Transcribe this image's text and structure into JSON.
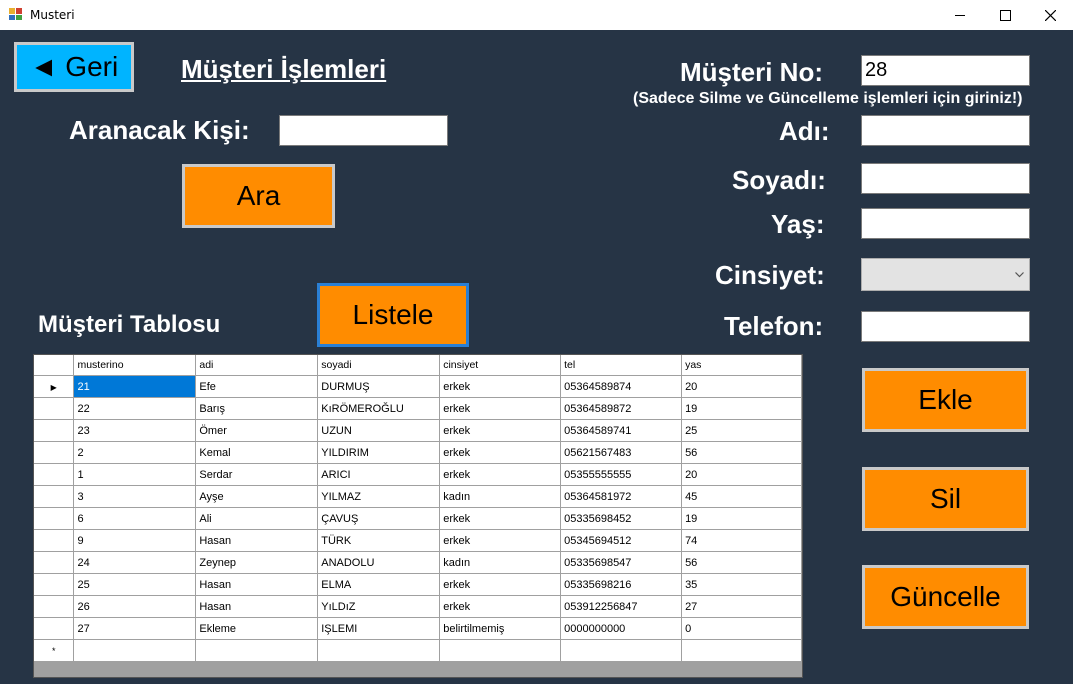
{
  "window": {
    "title": "Musteri",
    "minimize": "—",
    "maximize": "☐",
    "close": "✕"
  },
  "left": {
    "back_button": "◄ Geri",
    "heading": "Müşteri İşlemleri",
    "search_label": "Aranacak Kişi:",
    "search_value": "",
    "search_button": "Ara",
    "list_button": "Listele",
    "table_label": "Müşteri Tablosu"
  },
  "form": {
    "no_label": "Müşteri No:",
    "no_value": "28",
    "no_hint": "(Sadece Silme ve Güncelleme işlemleri için giriniz!)",
    "name_label": "Adı:",
    "name_value": "",
    "surname_label": "Soyadı:",
    "surname_value": "",
    "age_label": "Yaş:",
    "age_value": "",
    "gender_label": "Cinsiyet:",
    "gender_value": "",
    "phone_label": "Telefon:",
    "phone_value": "",
    "add_button": "Ekle",
    "delete_button": "Sil",
    "update_button": "Güncelle"
  },
  "grid": {
    "columns": [
      "musterino",
      "adi",
      "soyadi",
      "cinsiyet",
      "tel",
      "yas"
    ],
    "rows": [
      [
        "21",
        "Efe",
        "DURMUŞ",
        "erkek",
        "05364589874",
        "20"
      ],
      [
        "22",
        "Barış",
        "KıRÖMEROĞLU",
        "erkek",
        "05364589872",
        "19"
      ],
      [
        "23",
        "Ömer",
        "UZUN",
        "erkek",
        "05364589741",
        "25"
      ],
      [
        "2",
        "Kemal",
        "YILDIRIM",
        "erkek",
        "05621567483",
        "56"
      ],
      [
        "1",
        "Serdar",
        "ARICI",
        "erkek",
        "05355555555",
        "20"
      ],
      [
        "3",
        "Ayşe",
        "YILMAZ",
        "kadın",
        "05364581972",
        "45"
      ],
      [
        "6",
        "Ali",
        "ÇAVUŞ",
        "erkek",
        "05335698452",
        "19"
      ],
      [
        "9",
        "Hasan",
        "TÜRK",
        "erkek",
        "05345694512",
        "74"
      ],
      [
        "24",
        "Zeynep",
        "ANADOLU",
        "kadın",
        "05335698547",
        "56"
      ],
      [
        "25",
        "Hasan",
        "ELMA",
        "erkek",
        "05335698216",
        "35"
      ],
      [
        "26",
        "Hasan",
        "YıLDıZ",
        "erkek",
        "053912256847",
        "27"
      ],
      [
        "27",
        "Ekleme",
        "IŞLEMI",
        "belirtilmemiş",
        "0000000000",
        "0"
      ]
    ],
    "current_row_marker": "▶",
    "new_row_marker": "*",
    "selected_row": 0
  },
  "colors": {
    "background": "#263445",
    "button_orange": "#ff8c00",
    "back_button_blue": "#00b4ff",
    "selection_blue": "#0078d7"
  }
}
